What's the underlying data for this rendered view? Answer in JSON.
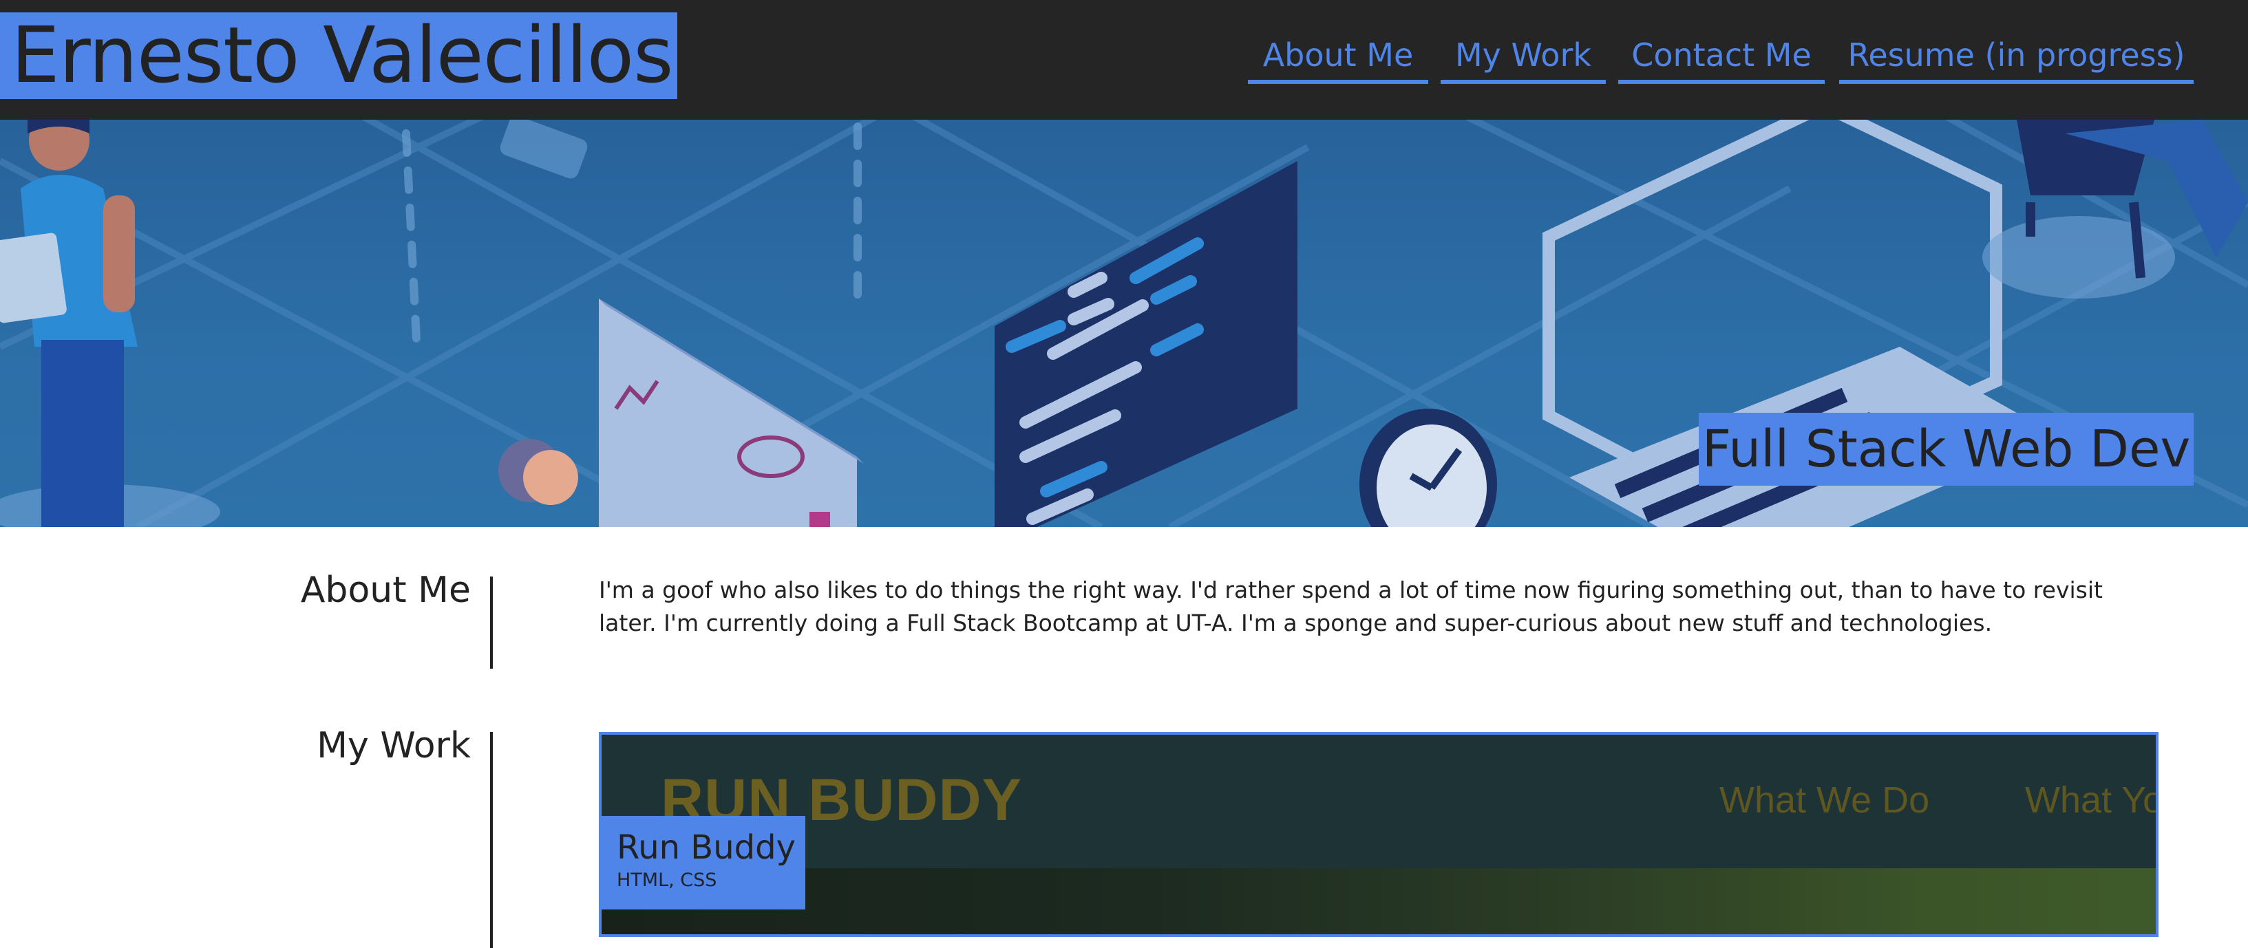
{
  "header": {
    "site_title": "Ernesto Valecillos",
    "nav": [
      {
        "label": "About Me"
      },
      {
        "label": "My Work"
      },
      {
        "label": "Contact Me"
      },
      {
        "label": "Resume (in progress)"
      }
    ]
  },
  "hero": {
    "tagline": "Full Stack Web Dev"
  },
  "about": {
    "heading": "About Me",
    "text": "I'm a goof who also likes to do things the right way. I'd rather spend a lot of time now figuring something out, than to have to revisit later. I'm currently doing a Full Stack Bootcamp at UT-A. I'm a sponge and super-curious about new stuff and technologies."
  },
  "work": {
    "heading": "My Work",
    "projects": [
      {
        "title": "Run Buddy",
        "tech": "HTML, CSS",
        "preview": {
          "logo": "RUN BUDDY",
          "nav": [
            "What We Do",
            "What Yo"
          ]
        }
      }
    ]
  },
  "colors": {
    "accent": "#4f84e8",
    "header_bg": "#252525",
    "hero_bg": "#2d6fa8",
    "text": "#222222"
  }
}
